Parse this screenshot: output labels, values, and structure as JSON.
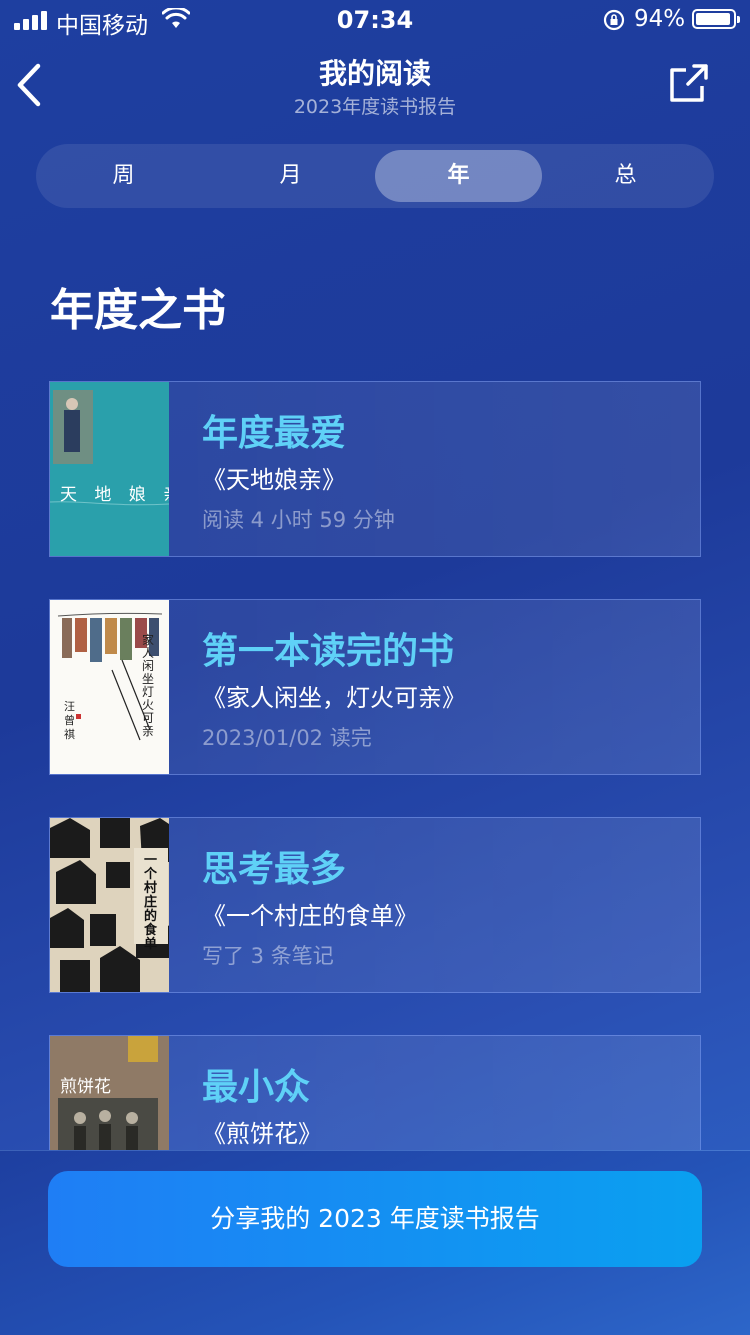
{
  "status_bar": {
    "carrier": "中国移动",
    "time": "07:34",
    "battery_pct": "94%"
  },
  "header": {
    "title": "我的阅读",
    "subtitle": "2023年度读书报告"
  },
  "tabs": [
    {
      "label": "周",
      "active": false
    },
    {
      "label": "月",
      "active": false
    },
    {
      "label": "年",
      "active": true
    },
    {
      "label": "总",
      "active": false
    }
  ],
  "section_title": "年度之书",
  "cards": [
    {
      "heading": "年度最爱",
      "book": "《天地娘亲》",
      "meta": "阅读 4 小时 59 分钟",
      "cover_title": "天 地 娘 亲"
    },
    {
      "heading": "第一本读完的书",
      "book": "《家人闲坐，灯火可亲》",
      "meta": "2023/01/02 读完",
      "cover_title": "家人闲坐 灯火可亲"
    },
    {
      "heading": "思考最多",
      "book": "《一个村庄的食单》",
      "meta": "写了 3 条笔记",
      "cover_title": "一个村庄的食单"
    },
    {
      "heading": "最小众",
      "book": "《煎饼花》",
      "meta": "",
      "cover_title": "煎饼花"
    }
  ],
  "cta_label": "分享我的 2023 年度读书报告",
  "colors": {
    "accent_heading": "#5fd1f7",
    "cta_start": "#1f7ef5",
    "cta_end": "#0aa0f0"
  }
}
